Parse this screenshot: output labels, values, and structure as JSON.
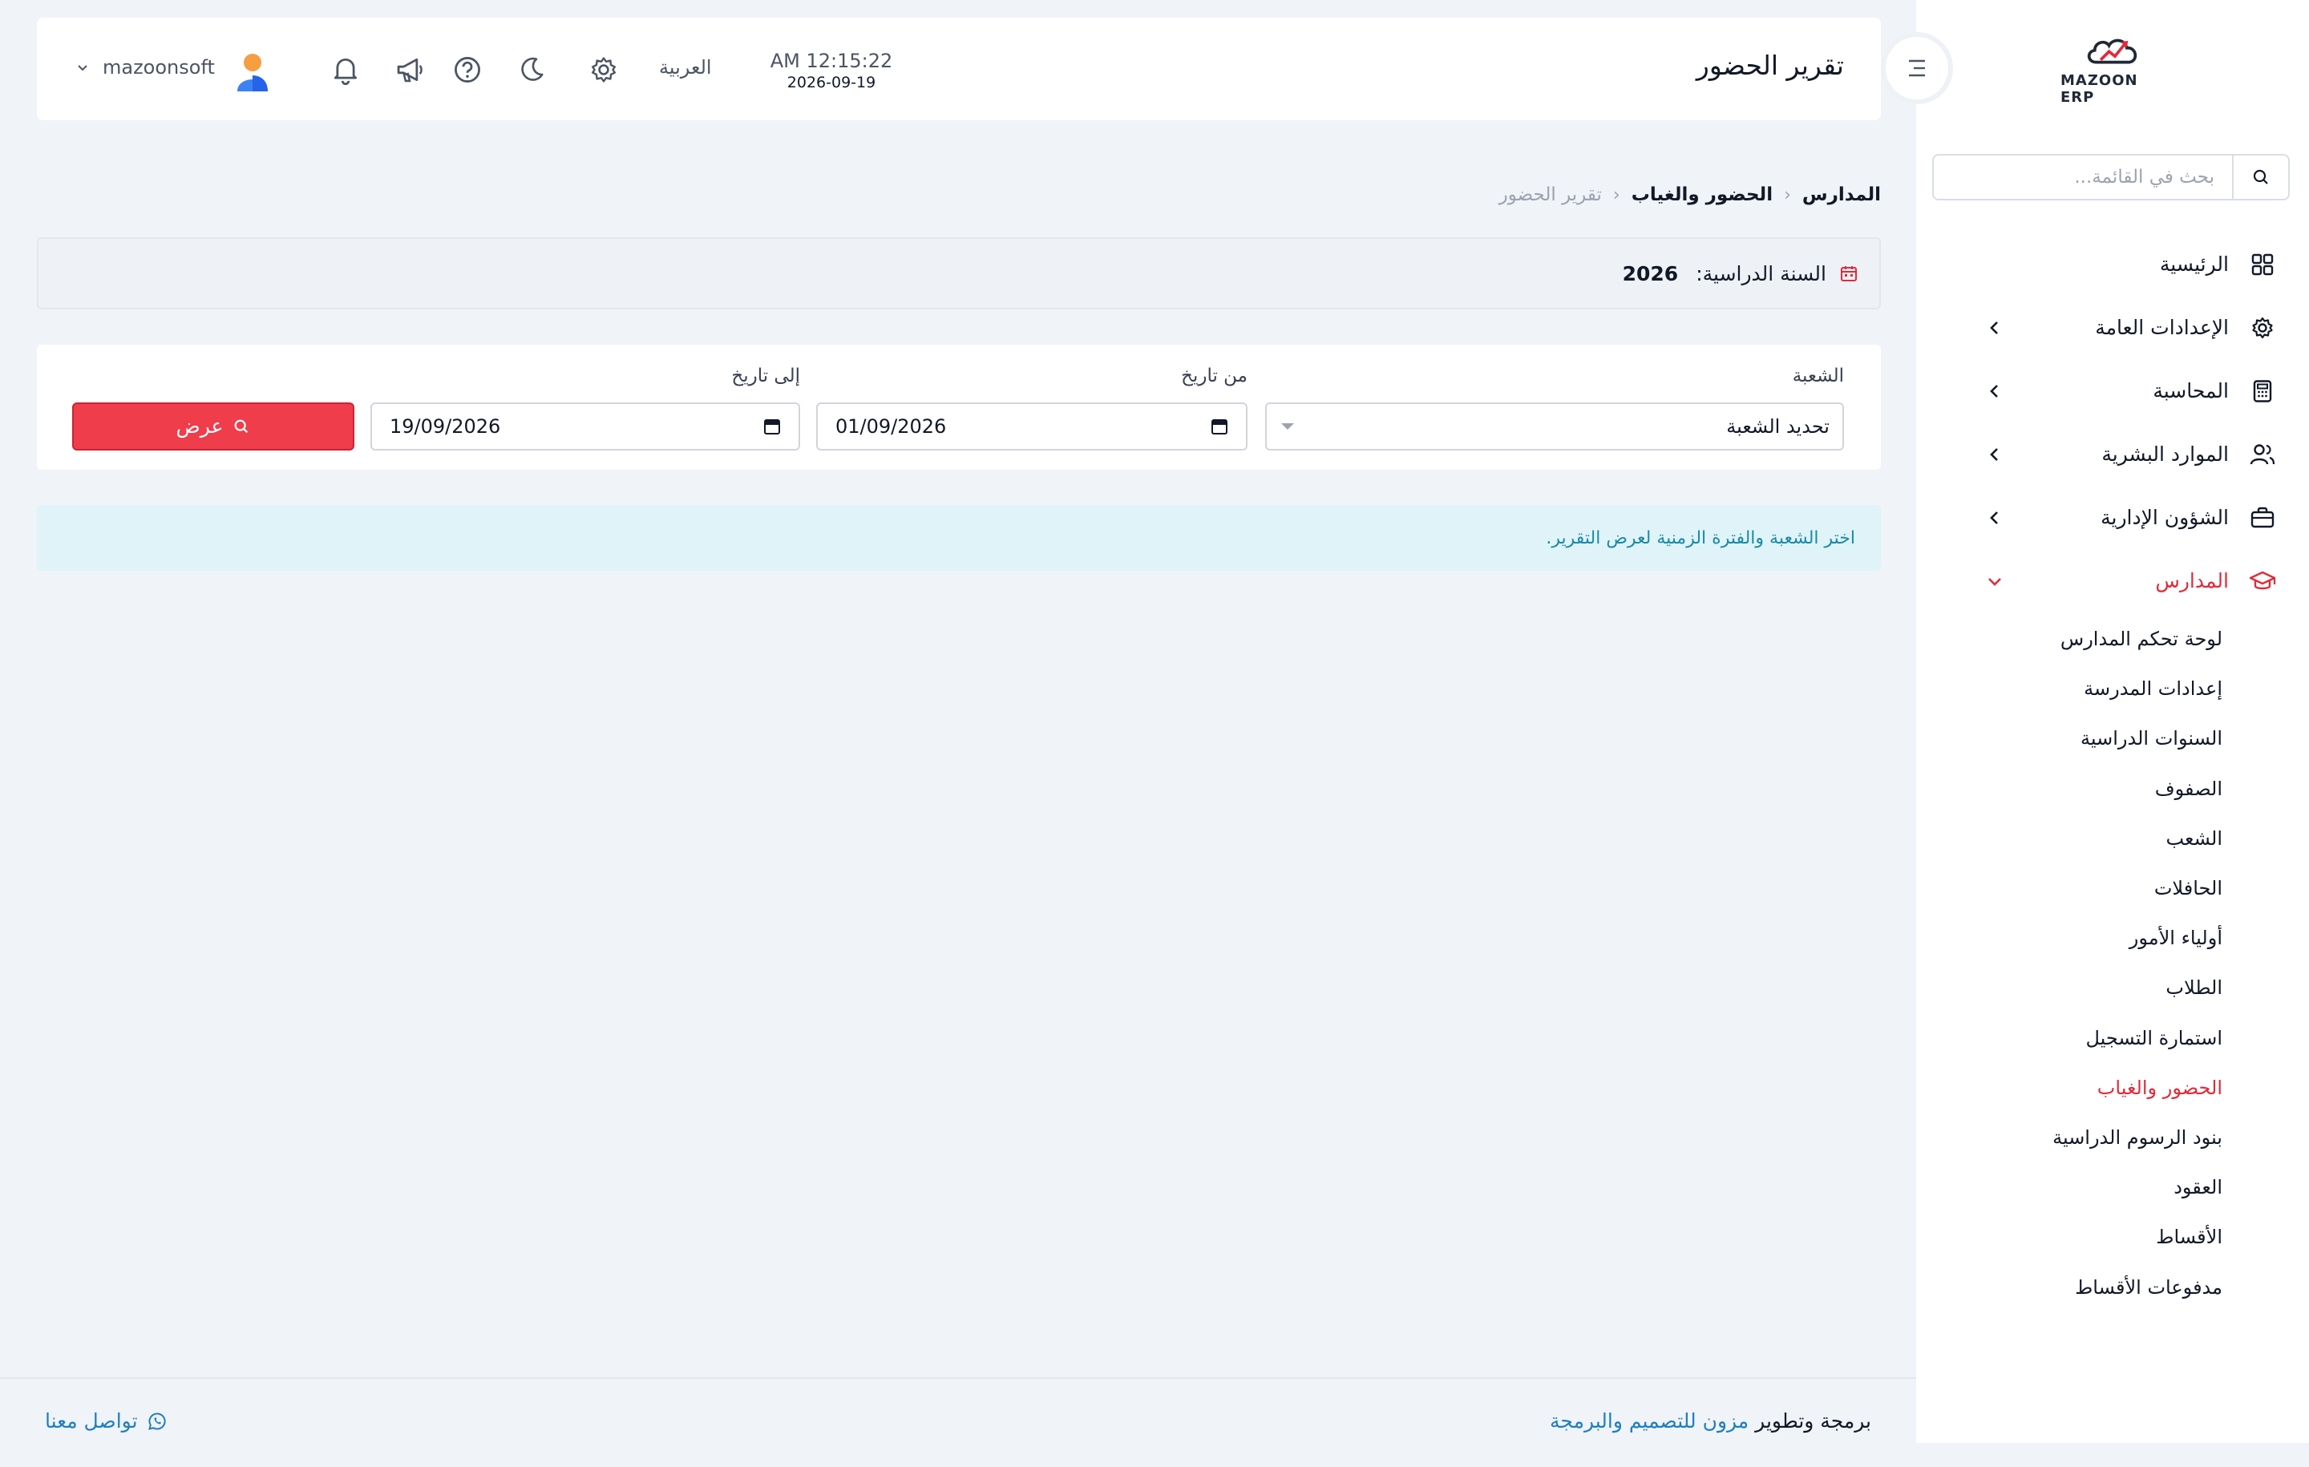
{
  "app": {
    "logo_text": "MAZOON ERP",
    "page_title": "تقرير الحضور"
  },
  "header": {
    "clock_time": "AM 12:15:22",
    "clock_date": "2026-09-19",
    "language": "العربية",
    "username": "mazoonsoft"
  },
  "sidebar": {
    "search_placeholder": "بحث في القائمة...",
    "items": [
      {
        "label": "الرئيسية"
      },
      {
        "label": "الإعدادات العامة"
      },
      {
        "label": "المحاسبة"
      },
      {
        "label": "الموارد البشرية"
      },
      {
        "label": "الشؤون الإدارية"
      },
      {
        "label": "المدارس"
      }
    ],
    "school_submenu": [
      "لوحة تحكم المدارس",
      "إعدادات المدرسة",
      "السنوات الدراسية",
      "الصفوف",
      "الشعب",
      "الحافلات",
      "أولياء الأمور",
      "الطلاب",
      "استمارة التسجيل",
      "الحضور والغياب",
      "بنود الرسوم الدراسية",
      "العقود",
      "الأقساط",
      "مدفوعات الأقساط"
    ]
  },
  "breadcrumb": {
    "level1": "المدارس",
    "level2": "الحضور والغياب",
    "current": "تقرير الحضور",
    "separator": "‹"
  },
  "year_bar": {
    "label": "السنة الدراسية:",
    "value": "2026"
  },
  "filter": {
    "section_label": "الشعبة",
    "section_placeholder": "تحديد الشعبة",
    "from_label": "من تاريخ",
    "from_value": "01/09/2026",
    "to_label": "إلى تاريخ",
    "to_value": "19/09/2026",
    "submit_label": "عرض"
  },
  "alert": {
    "message": "اختر الشعبة والفترة الزمنية لعرض التقرير."
  },
  "footer": {
    "credit_prefix": "برمجة وتطوير",
    "credit_link": "مزون للتصميم والبرمجة",
    "contact": "تواصل معنا"
  },
  "colors": {
    "accent": "#e02b3a",
    "button": "#ef3d4b",
    "info_bg": "#dff3f8",
    "info_text": "#1a8aa8",
    "link": "#1e7fc1"
  }
}
